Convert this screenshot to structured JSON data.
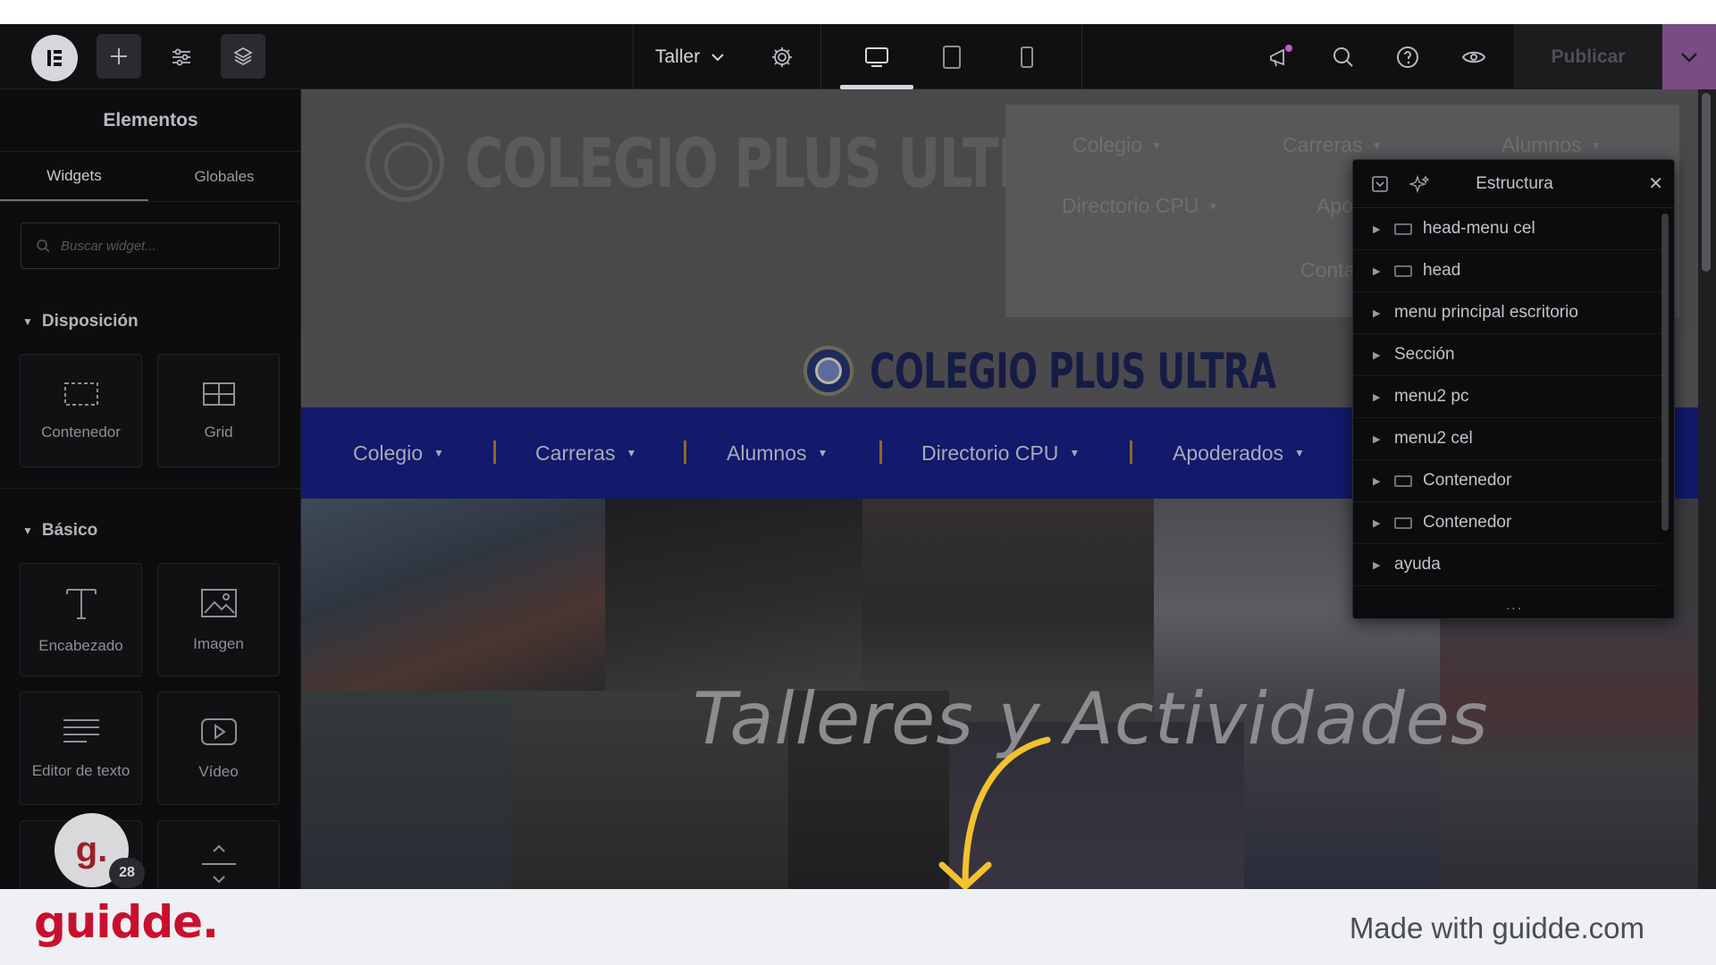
{
  "toolbar": {
    "page_name": "Taller",
    "publish_label": "Publicar",
    "icons": [
      "elementor-logo-icon",
      "add-icon",
      "sliders-icon",
      "layers-icon",
      "settings-gear-icon",
      "desktop-icon",
      "tablet-icon",
      "mobile-icon",
      "megaphone-icon",
      "search-icon",
      "help-icon",
      "eye-icon",
      "chevron-down-icon"
    ]
  },
  "panel": {
    "title": "Elementos",
    "tabs": [
      {
        "label": "Widgets",
        "active": true
      },
      {
        "label": "Globales",
        "active": false
      }
    ],
    "search_placeholder": "Buscar widget...",
    "sections": [
      {
        "title": "Disposición",
        "widgets": [
          {
            "label": "Contenedor",
            "icon": "container-icon"
          },
          {
            "label": "Grid",
            "icon": "grid-icon"
          }
        ]
      },
      {
        "title": "Básico",
        "widgets": [
          {
            "label": "Encabezado",
            "icon": "heading-icon"
          },
          {
            "label": "Imagen",
            "icon": "image-icon"
          },
          {
            "label": "Editor de texto",
            "icon": "text-editor-icon"
          },
          {
            "label": "Vídeo",
            "icon": "video-icon"
          },
          {
            "label": "",
            "icon": "button-icon"
          },
          {
            "label": "",
            "icon": "divider-icon"
          }
        ]
      }
    ]
  },
  "canvas": {
    "ghost_title": "COLEGIO PLUS ULTRA",
    "ghost_menu": [
      "Colegio",
      "Carreras",
      "Alumnos",
      "Directorio CPU",
      "Apo",
      "Conta"
    ],
    "site_title": "COLEGIO PLUS ULTRA",
    "nav": [
      "Colegio",
      "Carreras",
      "Alumnos",
      "Directorio CPU",
      "Apoderados"
    ],
    "hero_title": "Talleres y Actividades"
  },
  "structure": {
    "title": "Estructura",
    "rows": [
      {
        "label": "head-menu  cel",
        "container": true
      },
      {
        "label": "head",
        "container": true
      },
      {
        "label": "menu principal escritorio",
        "container": false
      },
      {
        "label": "Sección",
        "container": false
      },
      {
        "label": "menu2 pc",
        "container": false
      },
      {
        "label": "menu2 cel",
        "container": false
      },
      {
        "label": "Contenedor",
        "container": true
      },
      {
        "label": "Contenedor",
        "container": true
      },
      {
        "label": "ayuda",
        "container": false
      }
    ],
    "more": "..."
  },
  "overlay": {
    "avatar_letter": "g.",
    "avatar_count": "28"
  },
  "footer": {
    "brand": "guidde.",
    "made_with": "Made with guidde.com"
  },
  "colors": {
    "nav_bg": "#13196b",
    "publish_dropdown": "#7a4c86",
    "brand_red": "#c8102e"
  }
}
